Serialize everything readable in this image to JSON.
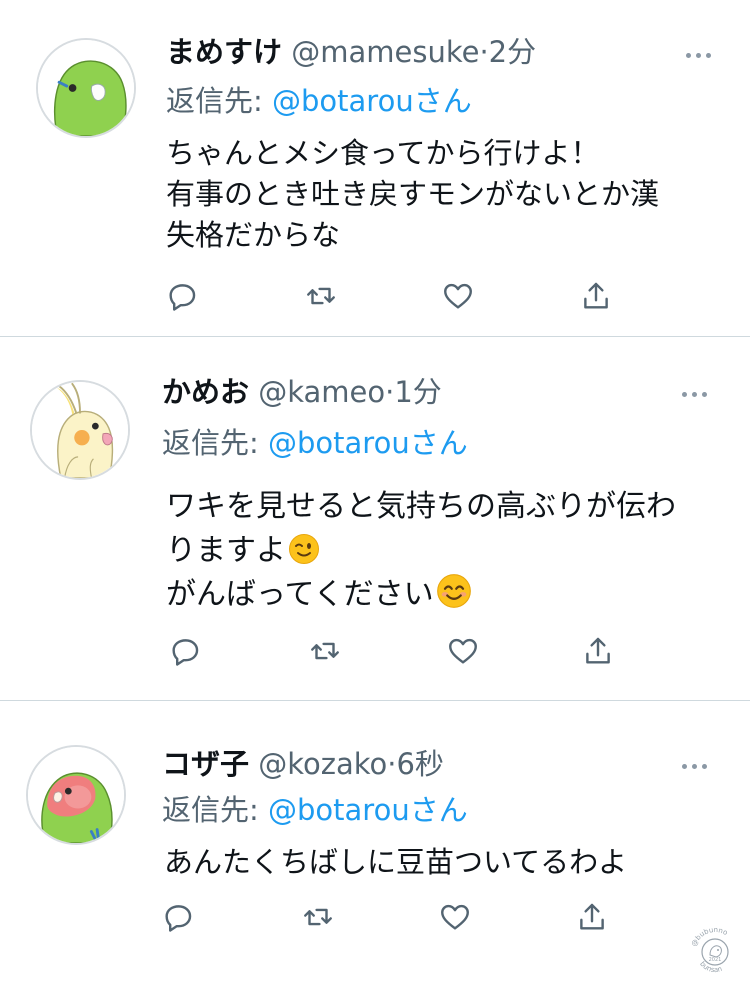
{
  "colors": {
    "accent": "#1d9bf0",
    "muted": "#536471",
    "divider": "#cfd9de"
  },
  "tweets": [
    {
      "name": "まめすけ",
      "handle": "@mamesuke",
      "separator": "·",
      "time": "2分",
      "reply_label": "返信先:",
      "reply_to": "@botarou",
      "reply_suffix": "さん",
      "lines": [
        "ちゃんとメシ食ってから行けよ！",
        "有事のとき吐き戻すモンがないとか漢",
        "失格だからな"
      ],
      "avatar_icon": "green-parakeet-avatar"
    },
    {
      "name": "かめお",
      "handle": "@kameo",
      "separator": "·",
      "time": "1分",
      "reply_label": "返信先:",
      "reply_to": "@botarou",
      "reply_suffix": "さん",
      "lines": [
        "ワキを見せると気持ちの高ぶりが伝わ",
        "りますよ",
        "がんばってください"
      ],
      "emojis": [
        "winking-face-emoji",
        "smiling-face-emoji"
      ],
      "avatar_icon": "cockatiel-avatar"
    },
    {
      "name": "コザ子",
      "handle": "@kozako",
      "separator": "·",
      "time": "6秒",
      "reply_label": "返信先:",
      "reply_to": "@botarou",
      "reply_suffix": "さん",
      "lines": [
        "あんたくちばしに豆苗ついてるわよ"
      ],
      "avatar_icon": "lovebird-avatar"
    }
  ],
  "action_icons": [
    "reply-icon",
    "retweet-icon",
    "like-icon",
    "share-icon"
  ],
  "watermark": {
    "top_text": "@bubunno",
    "bottom_text": "bunsan",
    "year": "2021"
  }
}
